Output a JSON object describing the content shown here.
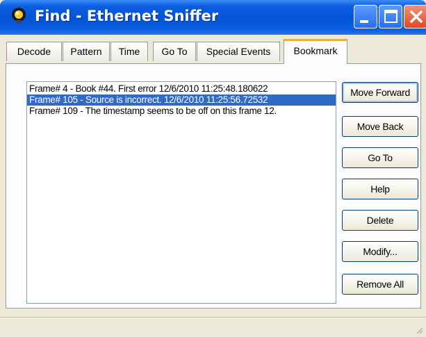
{
  "window": {
    "title": "Find - Ethernet Sniffer",
    "icon": "lightbulb-icon"
  },
  "tabs": [
    {
      "label": "Decode",
      "active": false
    },
    {
      "label": "Pattern",
      "active": false
    },
    {
      "label": "Time",
      "active": false
    },
    {
      "label": "Go To",
      "active": false
    },
    {
      "label": "Special Events",
      "active": false
    },
    {
      "label": "Bookmark",
      "active": true
    }
  ],
  "bookmarks": [
    {
      "text": "Frame# 4 - Book #44.  First error  12/6/2010 11:25:48.180622",
      "selected": false
    },
    {
      "text": "Frame# 105 - Source is incorrect.  12/6/2010 11:25:56.72532",
      "selected": true
    },
    {
      "text": "Frame# 109 - The timestamp seems to be off on this frame  12.",
      "selected": false
    }
  ],
  "buttons": {
    "move_forward": "Move Forward",
    "move_back": "Move Back",
    "go_to": "Go To",
    "help": "Help",
    "delete": "Delete",
    "modify": "Modify...",
    "remove_all": "Remove All"
  },
  "colors": {
    "titlebar": "#0554d8",
    "selection": "#316ac5",
    "active_tab_accent": "#e9b13a"
  }
}
